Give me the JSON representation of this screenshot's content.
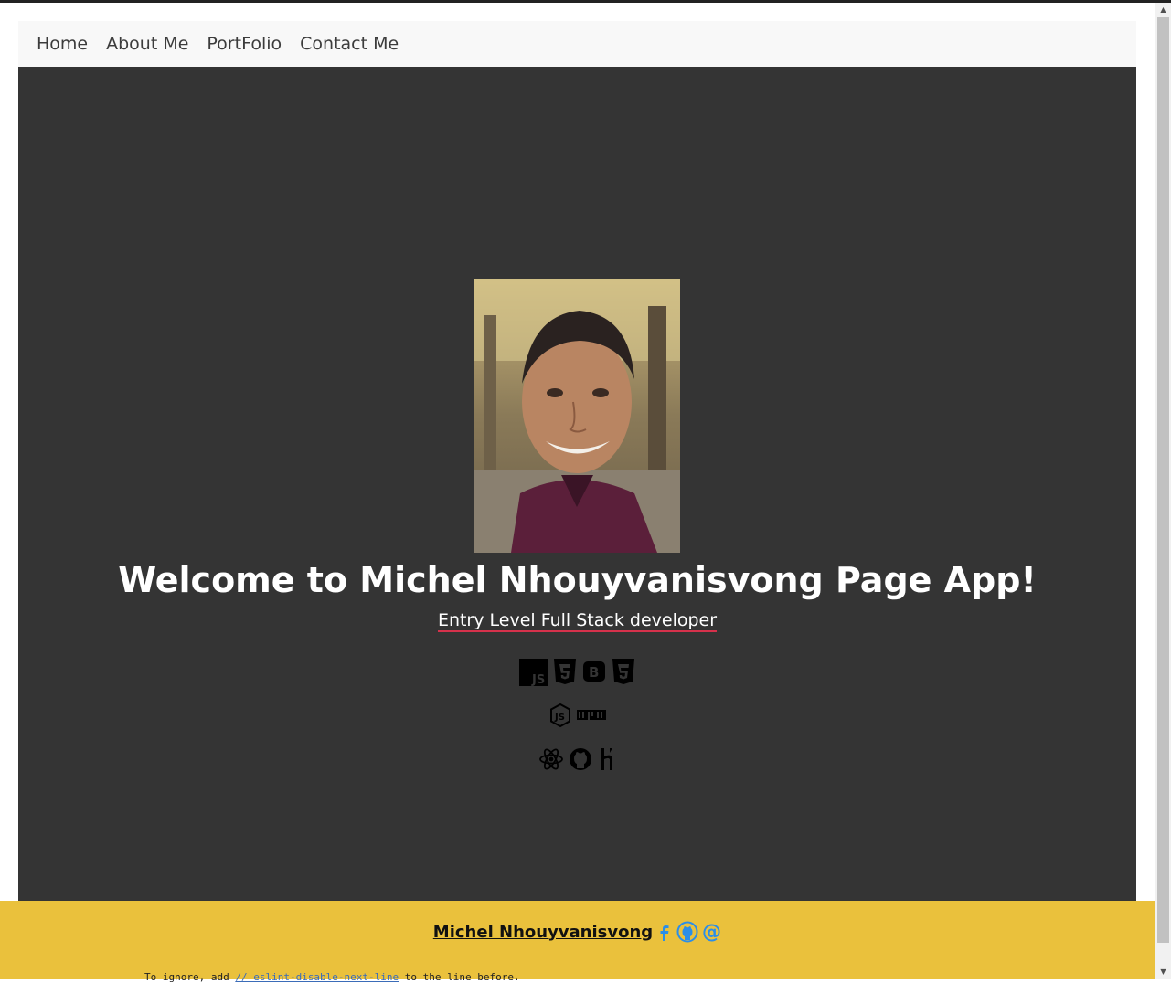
{
  "nav": {
    "items": [
      {
        "label": "Home"
      },
      {
        "label": "About Me"
      },
      {
        "label": "PortFolio"
      },
      {
        "label": "Contact Me"
      }
    ]
  },
  "hero": {
    "title": "Welcome to Michel Nhouyvanisvong Page App!",
    "subtitle": "Entry Level Full Stack developer",
    "tech_icons": [
      [
        "javascript-icon",
        "html5-icon",
        "bootstrap-icon",
        "css3-icon"
      ],
      [
        "nodejs-icon",
        "npm-icon"
      ],
      [
        "react-icon",
        "github-icon",
        "heroku-icon"
      ]
    ]
  },
  "footer": {
    "name": "Michel Nhouyvanisvong",
    "links": [
      "facebook-icon",
      "github-icon",
      "email-icon"
    ]
  },
  "console_overlay": {
    "prefix": "To ignore, add ",
    "code": "// eslint-disable-next-line",
    "suffix": " to the line before."
  },
  "colors": {
    "hero_bg": "#343434",
    "navbar_bg": "#f8f8f8",
    "footer_bg": "#eac13c",
    "accent_underline": "#d6314b",
    "footer_icon": "#2b8ee8"
  }
}
